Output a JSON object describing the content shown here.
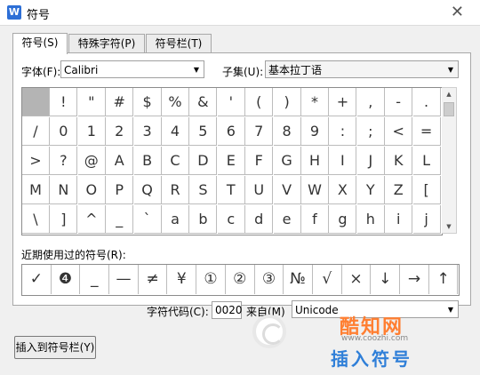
{
  "window": {
    "title": "符号",
    "app_icon": "W"
  },
  "tabs": [
    {
      "label": "符号(S)",
      "active": true
    },
    {
      "label": "特殊字符(P)",
      "active": false
    },
    {
      "label": "符号栏(T)",
      "active": false
    }
  ],
  "font": {
    "label": "字体(F):",
    "value": "Calibri"
  },
  "subset": {
    "label": "子集(U):",
    "value": "基本拉丁语"
  },
  "grid_rows": [
    [
      " ",
      "!",
      "\"",
      "#",
      "$",
      "%",
      "&",
      "'",
      "(",
      ")",
      "*",
      "+",
      ",",
      "-",
      "."
    ],
    [
      "/",
      "0",
      "1",
      "2",
      "3",
      "4",
      "5",
      "6",
      "7",
      "8",
      "9",
      ":",
      ";",
      "<",
      "="
    ],
    [
      ">",
      "?",
      "@",
      "A",
      "B",
      "C",
      "D",
      "E",
      "F",
      "G",
      "H",
      "I",
      "J",
      "K",
      "L"
    ],
    [
      "M",
      "N",
      "O",
      "P",
      "Q",
      "R",
      "S",
      "T",
      "U",
      "V",
      "W",
      "X",
      "Y",
      "Z",
      "["
    ],
    [
      "\\",
      "]",
      "^",
      "_",
      "`",
      "a",
      "b",
      "c",
      "d",
      "e",
      "f",
      "g",
      "h",
      "i",
      "j"
    ]
  ],
  "recent": {
    "label": "近期使用过的符号(R):",
    "symbols": [
      "✓",
      "❹",
      "_",
      "—",
      "≠",
      "¥",
      "①",
      "②",
      "③",
      "№",
      "√",
      "×",
      "↓",
      "→",
      "↑"
    ]
  },
  "charcode": {
    "label": "字符代码(C):",
    "value": "0020"
  },
  "from": {
    "label": "来自(M)",
    "value": "Unicode"
  },
  "insert_button": "插入到符号栏(Y)",
  "watermark": {
    "brand": "酷知网",
    "url": "www.coozhi.com",
    "footer": "插入符号"
  },
  "icons": {
    "close": "close-icon",
    "dropdown": "chevron-down-icon"
  }
}
